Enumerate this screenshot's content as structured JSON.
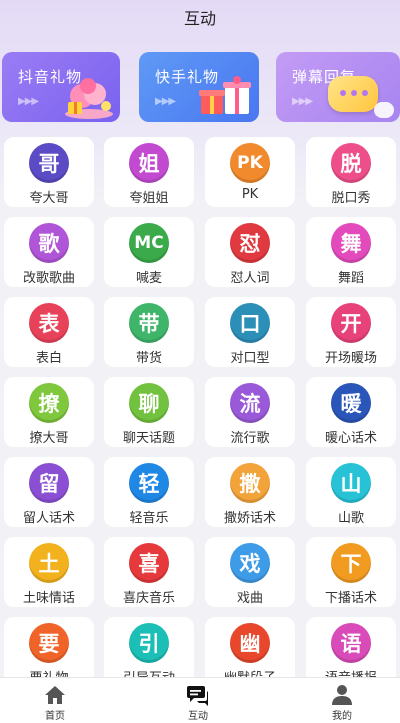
{
  "header": {
    "title": "互动"
  },
  "top_cards": [
    {
      "label": "抖音礼物",
      "arrows": "▶▶▶",
      "color": "#8a6ff2"
    },
    {
      "label": "快手礼物",
      "arrows": "▶▶▶",
      "color": "#5384f3"
    },
    {
      "label": "弹幕回复",
      "arrows": "▶▶▶",
      "color": "#b58ff3"
    }
  ],
  "grid_items": [
    {
      "glyph": "哥",
      "label": "夸大哥",
      "color": "#5b4bc4"
    },
    {
      "glyph": "姐",
      "label": "夸姐姐",
      "color": "#c24ad1"
    },
    {
      "glyph": "PK",
      "label": "PK",
      "color": "#f08a2c"
    },
    {
      "glyph": "脱",
      "label": "脱口秀",
      "color": "#ee4f8a"
    },
    {
      "glyph": "歌",
      "label": "改歌歌曲",
      "color": "#b055d8"
    },
    {
      "glyph": "MC",
      "label": "喊麦",
      "color": "#3aaa4a"
    },
    {
      "glyph": "怼",
      "label": "怼人词",
      "color": "#e0393f"
    },
    {
      "glyph": "舞",
      "label": "舞蹈",
      "color": "#e34bbd"
    },
    {
      "glyph": "表",
      "label": "表白",
      "color": "#e8425a"
    },
    {
      "glyph": "带",
      "label": "带货",
      "color": "#3fb56a"
    },
    {
      "glyph": "口",
      "label": "对口型",
      "color": "#2c8fb8"
    },
    {
      "glyph": "开",
      "label": "开场暖场",
      "color": "#e8427a"
    },
    {
      "glyph": "撩",
      "label": "撩大哥",
      "color": "#7fc73d"
    },
    {
      "glyph": "聊",
      "label": "聊天话题",
      "color": "#72c23f"
    },
    {
      "glyph": "流",
      "label": "流行歌",
      "color": "#9a59d8"
    },
    {
      "glyph": "暖",
      "label": "暖心话术",
      "color": "#2a55b9"
    },
    {
      "glyph": "留",
      "label": "留人话术",
      "color": "#8a4fd2"
    },
    {
      "glyph": "轻",
      "label": "轻音乐",
      "color": "#1f88e5"
    },
    {
      "glyph": "撒",
      "label": "撒娇话术",
      "color": "#f2a33a"
    },
    {
      "glyph": "山",
      "label": "山歌",
      "color": "#27c2d6"
    },
    {
      "glyph": "土",
      "label": "土味情话",
      "color": "#f2b21e"
    },
    {
      "glyph": "喜",
      "label": "喜庆音乐",
      "color": "#e5393c"
    },
    {
      "glyph": "戏",
      "label": "戏曲",
      "color": "#3e9be8"
    },
    {
      "glyph": "下",
      "label": "下播话术",
      "color": "#f29b21"
    },
    {
      "glyph": "要",
      "label": "要礼物",
      "color": "#f0642a"
    },
    {
      "glyph": "引",
      "label": "引导互动",
      "color": "#1bbfb5"
    },
    {
      "glyph": "幽",
      "label": "幽默段子",
      "color": "#e8472c"
    },
    {
      "glyph": "语",
      "label": "语音播报",
      "color": "#d94bb8"
    }
  ],
  "bottom_nav": [
    {
      "label": "首页",
      "icon": "home-icon"
    },
    {
      "label": "互动",
      "icon": "chat-icon"
    },
    {
      "label": "我的",
      "icon": "user-icon"
    }
  ]
}
